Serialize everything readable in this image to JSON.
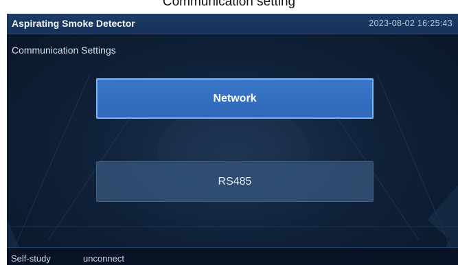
{
  "caption": "Communication setting",
  "header": {
    "app_title": "Aspirating Smoke Detector",
    "datetime": "2023-08-02  16:25:43"
  },
  "page": {
    "title": "Communication Settings"
  },
  "options": {
    "network_label": "Network",
    "rs485_label": "RS485",
    "selected": "Network"
  },
  "status": {
    "mode": "Self-study",
    "connection": "unconnect"
  },
  "colors": {
    "screen_bg": "#10213a",
    "titlebar": "#1d3b66",
    "selected_button": "#3a76c8",
    "selected_border": "#7fb2f0",
    "unselected_button": "#345278"
  }
}
